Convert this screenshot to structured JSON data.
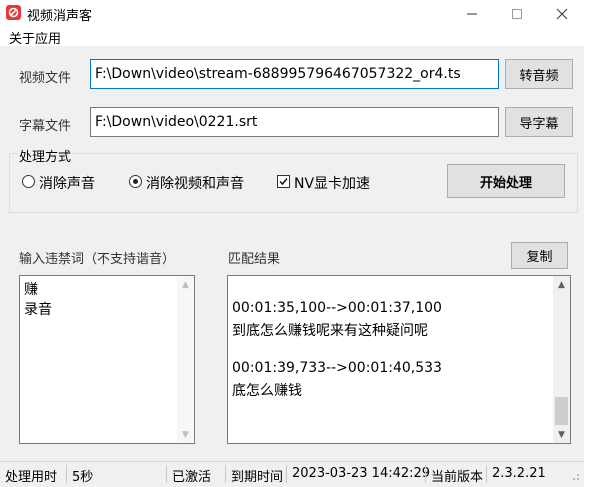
{
  "window": {
    "title": "视频消声客"
  },
  "menu": {
    "about": "关于应用"
  },
  "video": {
    "label": "视频文件",
    "value": "F:\\Down\\video\\stream-688995796467057322_or4.ts",
    "button": "转音频"
  },
  "subtitle": {
    "label": "字幕文件",
    "value": "F:\\Down\\video\\0221.srt",
    "button": "导字幕"
  },
  "processing": {
    "title": "处理方式",
    "option_mute_audio": "消除声音",
    "option_mute_video_audio": "消除视频和声音",
    "selected": "消除视频和声音",
    "nv_accel": "NV显卡加速",
    "nv_accel_checked": true,
    "start_button": "开始处理"
  },
  "keywords": {
    "label": "输入违禁词（不支持谐音）",
    "lines": [
      "赚",
      "录音"
    ]
  },
  "results": {
    "label": "匹配结果",
    "copy_button": "复制",
    "lines": [
      "00:01:35,100-->00:01:37,100",
      "到底怎么赚钱呢来有这种疑问呢",
      "",
      "00:01:39,733-->00:01:40,533",
      "底怎么赚钱"
    ]
  },
  "status": {
    "elapsed_label": "处理用时",
    "elapsed_value": "5秒",
    "activation": "已激活",
    "expiry_label": "到期时间",
    "expiry_value": "2023-03-23 14:42:29",
    "version_label": "当前版本",
    "version_value": "2.3.2.21"
  }
}
